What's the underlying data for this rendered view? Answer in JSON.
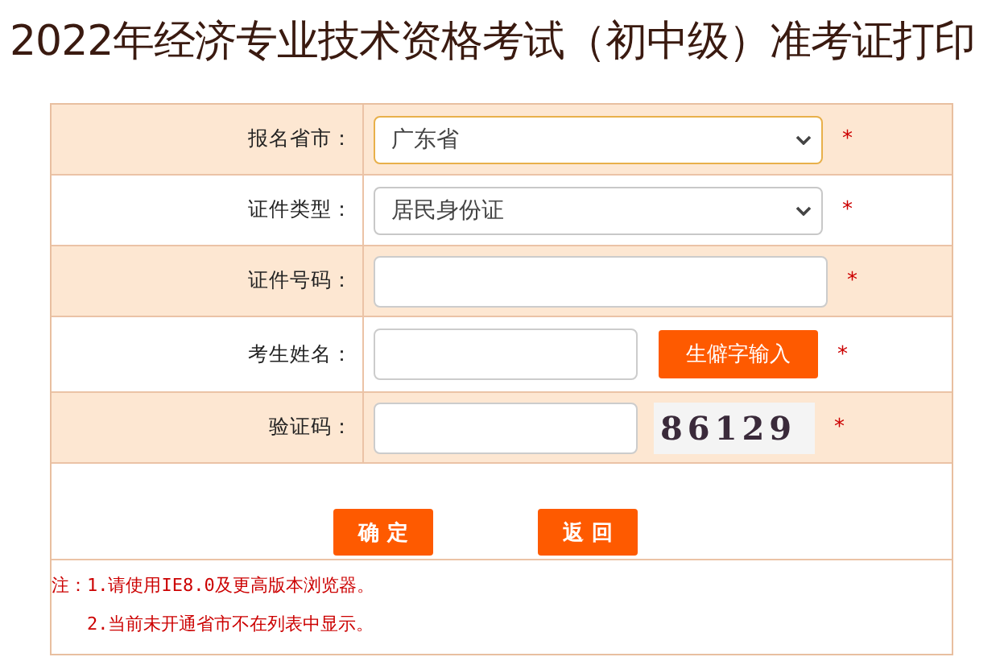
{
  "title": "2022年经济专业技术资格考试（初中级）准考证打印",
  "fields": [
    {
      "kind": "select",
      "label": "报名省市：",
      "value": "广东省",
      "required_mark": "*",
      "shaded": true
    },
    {
      "kind": "select",
      "label": "证件类型：",
      "value": "居民身份证",
      "required_mark": "*",
      "shaded": false
    },
    {
      "kind": "input",
      "label": "证件号码：",
      "required_mark": "*",
      "shaded": true
    },
    {
      "kind": "input_button",
      "label": "考生姓名：",
      "button": "生僻字输入",
      "required_mark": "*",
      "shaded": false
    },
    {
      "kind": "captcha",
      "label": "验证码：",
      "captcha": "86129",
      "required_mark": "*",
      "shaded": true
    }
  ],
  "buttons": [
    "确 定",
    "返 回"
  ],
  "notes": [
    "注：1.请使用IE8.0及更高版本浏览器。",
    "2.当前未开通省市不在列表中显示。"
  ]
}
